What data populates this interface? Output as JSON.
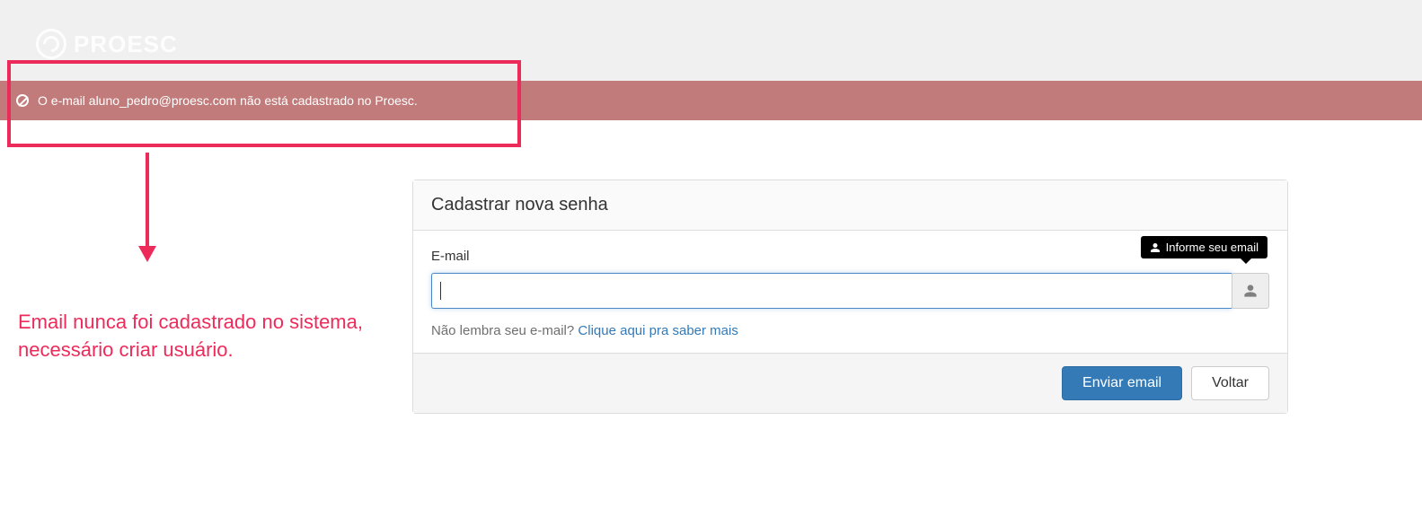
{
  "colors": {
    "accent_pink": "#ed2b5a",
    "primary_blue": "#337ab7",
    "banner_red": "#c17b7b"
  },
  "logo": {
    "text": "PROESC"
  },
  "error_banner": {
    "message": "O e-mail aluno_pedro@proesc.com não está cadastrado no Proesc."
  },
  "callout": {
    "caption": "Email nunca foi cadastrado no sistema, necessário criar usuário."
  },
  "panel": {
    "title": "Cadastrar nova senha",
    "email_label": "E-mail",
    "email_value": "",
    "tooltip_text": "Informe seu email",
    "help_prefix": "Não lembra seu e-mail? ",
    "help_link_text": "Clique aqui pra saber mais",
    "submit_label": "Enviar email",
    "back_label": "Voltar"
  }
}
